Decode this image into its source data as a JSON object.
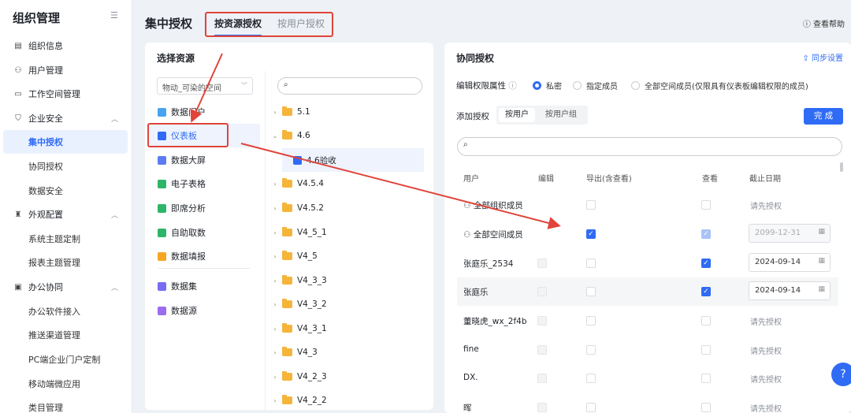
{
  "sidebar": {
    "title": "组织管理",
    "items": [
      {
        "label": "组织信息",
        "icon": "building-icon"
      },
      {
        "label": "用户管理",
        "icon": "users-icon"
      },
      {
        "label": "工作空间管理",
        "icon": "workspace-icon"
      },
      {
        "label": "企业安全",
        "icon": "shield-icon"
      },
      {
        "label": "集中授权"
      },
      {
        "label": "协同授权"
      },
      {
        "label": "数据安全"
      },
      {
        "label": "外观配置",
        "icon": "shirt-icon"
      },
      {
        "label": "系统主题定制"
      },
      {
        "label": "报表主题管理"
      },
      {
        "label": "办公协同",
        "icon": "briefcase-icon"
      },
      {
        "label": "办公软件接入"
      },
      {
        "label": "推送渠道管理"
      },
      {
        "label": "PC端企业门户定制"
      },
      {
        "label": "移动端微应用"
      },
      {
        "label": "类目管理"
      }
    ]
  },
  "header": {
    "title": "集中授权",
    "tabs": [
      "按资源授权",
      "按用户授权"
    ],
    "help": "查看帮助"
  },
  "left_panel": {
    "title": "选择资源",
    "workspace_select": "物动_可染的空间",
    "resources": [
      "数据门户",
      "仪表板",
      "数据大屏",
      "电子表格",
      "即席分析",
      "自助取数",
      "数据填报",
      "数据集",
      "数据源"
    ],
    "tree": [
      "5.1",
      "4.6",
      "4.6验收",
      "V4.5.4",
      "V4.5.2",
      "V4_5_1",
      "V4_5",
      "V4_3_3",
      "V4_3_2",
      "V4_3_1",
      "V4_3",
      "V4_2_3",
      "V4_2_2"
    ]
  },
  "right_panel": {
    "title": "协同授权",
    "sync": "同步设置",
    "edit_attr_label": "编辑权限属性",
    "radio_options": [
      "私密",
      "指定成员",
      "全部空间成员(仅限具有仪表板编辑权限的成员)"
    ],
    "add_label": "添加授权",
    "seg": [
      "按用户",
      "按用户组"
    ],
    "done": "完 成",
    "columns": [
      "用户",
      "编辑",
      "导出(含查看)",
      "查看",
      "截止日期"
    ],
    "rows": [
      {
        "user": "全部组织成员",
        "date": "请先授权"
      },
      {
        "user": "全部空间成员",
        "date": "2099-12-31"
      },
      {
        "user": "张庭乐_2534",
        "date": "2024-09-14"
      },
      {
        "user": "张庭乐",
        "date": "2024-09-14"
      },
      {
        "user": "董晓虎_wx_2f4b",
        "date": "请先授权"
      },
      {
        "user": "fine",
        "date": "请先授权"
      },
      {
        "user": "DX.",
        "date": "请先授权"
      },
      {
        "user": "晖",
        "date": "请先授权"
      }
    ]
  },
  "colors": {
    "accent": "#2f6bf5",
    "annotation": "#e0443a"
  }
}
